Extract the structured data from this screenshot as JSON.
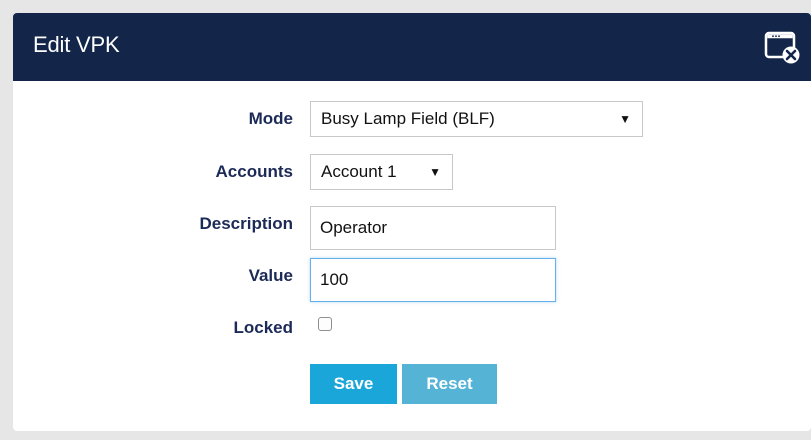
{
  "dialog": {
    "title": "Edit VPK"
  },
  "form": {
    "mode": {
      "label": "Mode",
      "value": "Busy Lamp Field (BLF)"
    },
    "accounts": {
      "label": "Accounts",
      "value": "Account 1"
    },
    "description": {
      "label": "Description",
      "value": "Operator"
    },
    "value": {
      "label": "Value",
      "value": "100"
    },
    "locked": {
      "label": "Locked",
      "checked": false
    }
  },
  "buttons": {
    "save_label": "Save",
    "reset_label": "Reset"
  },
  "colors": {
    "title_bar": "#13264a",
    "label_text": "#1c2a57",
    "save_button": "#1aa6d9",
    "reset_button": "#55b4d6",
    "focus_border": "#66afe9"
  },
  "icons": {
    "close": "close-window-icon",
    "dropdown": "triangle-down-icon"
  }
}
